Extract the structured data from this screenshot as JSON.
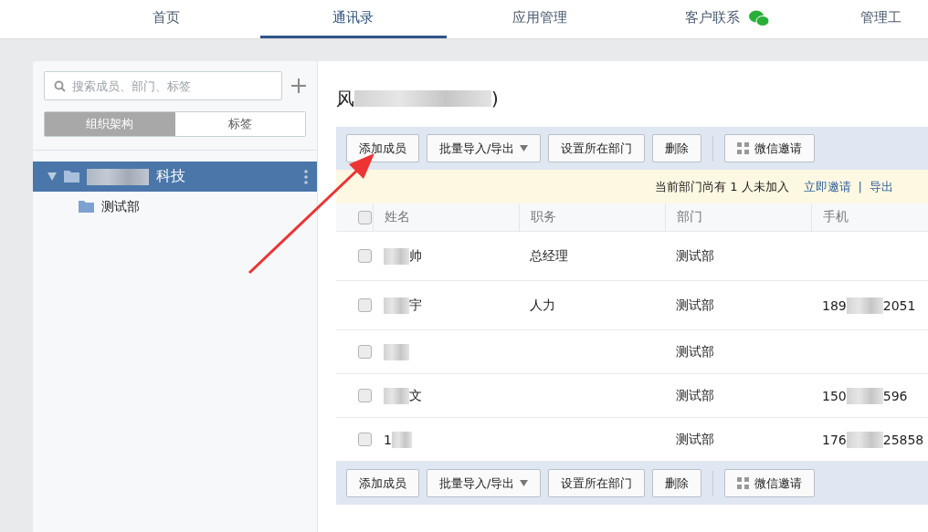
{
  "nav": {
    "items": [
      {
        "label": "首页",
        "selected": false,
        "kind": "plain"
      },
      {
        "label": "通讯录",
        "selected": true,
        "kind": "plain"
      },
      {
        "label": "应用管理",
        "selected": false,
        "kind": "plain"
      },
      {
        "label": "客户联系",
        "selected": false,
        "kind": "chat"
      },
      {
        "label": "管理工",
        "selected": false,
        "kind": "plain"
      }
    ]
  },
  "sidebar": {
    "search": {
      "placeholder": "搜索成员、部门、标签"
    },
    "tabs": [
      {
        "label": "组织架构",
        "selected": true
      },
      {
        "label": "标签",
        "selected": false
      }
    ],
    "tree": [
      {
        "label": "科技",
        "selected": true,
        "expanded": true,
        "children": [
          {
            "label": "测试部",
            "selected": false
          }
        ]
      }
    ]
  },
  "main": {
    "title_start": "风",
    "title_end": ")",
    "toolbar": [
      {
        "label": "添加成员",
        "kind": "plain"
      },
      {
        "label": "批量导入/导出",
        "kind": "dropdown"
      },
      {
        "label": "设置所在部门",
        "kind": "plain"
      },
      {
        "label": "删除",
        "kind": "plain"
      },
      {
        "label": "微信邀请",
        "kind": "qr"
      }
    ],
    "notice": {
      "text": "当前部门尚有 1 人未加入",
      "links": [
        "立即邀请",
        "导出"
      ],
      "separator": "|"
    },
    "table": {
      "all_checked": false,
      "columns": [
        "姓名",
        "职务",
        "部门",
        "手机"
      ],
      "rows": [
        {
          "checked": false,
          "name_end": "帅",
          "role": "总经理",
          "dept": "测试部"
        },
        {
          "checked": false,
          "name_end": "宇",
          "role": "人力",
          "dept": "测试部",
          "phone_start": "189",
          "phone_end": "2051"
        },
        {
          "checked": false,
          "dept": "测试部"
        },
        {
          "checked": false,
          "name_end": "文",
          "dept": "测试部",
          "phone_start": "150",
          "phone_end": "596"
        },
        {
          "checked": false,
          "name_start": "1",
          "dept": "测试部",
          "phone_start": "176",
          "phone_end": "25858"
        }
      ]
    },
    "bottom_toolbar": [
      {
        "label": "添加成员",
        "kind": "plain"
      },
      {
        "label": "批量导入/导出",
        "kind": "dropdown"
      },
      {
        "label": "设置所在部门",
        "kind": "plain"
      },
      {
        "label": "删除",
        "kind": "plain"
      },
      {
        "label": "微信邀请",
        "kind": "qr"
      }
    ]
  }
}
